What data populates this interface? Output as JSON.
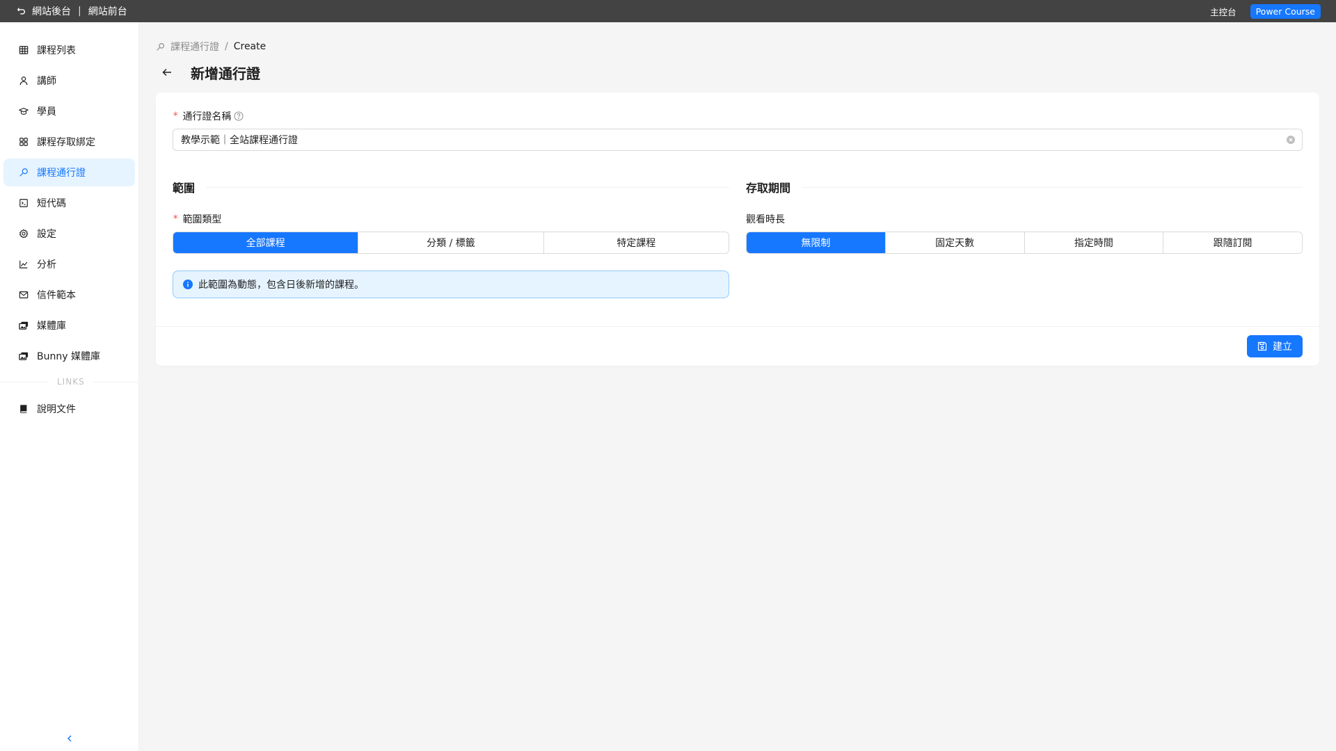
{
  "topbar": {
    "backend_label": "網站後台",
    "separator": "|",
    "frontend_label": "網站前台",
    "console_label": "主控台",
    "brand_label": "Power Course"
  },
  "sidebar": {
    "items": [
      {
        "label": "課程列表",
        "icon": "table-icon"
      },
      {
        "label": "講師",
        "icon": "user-icon"
      },
      {
        "label": "學員",
        "icon": "student-cap-icon"
      },
      {
        "label": "課程存取綁定",
        "icon": "apps-icon"
      },
      {
        "label": "課程通行證",
        "icon": "key-icon",
        "active": true
      },
      {
        "label": "短代碼",
        "icon": "code-icon"
      },
      {
        "label": "設定",
        "icon": "gear-icon"
      },
      {
        "label": "分析",
        "icon": "chart-line-icon"
      },
      {
        "label": "信件範本",
        "icon": "mail-icon"
      },
      {
        "label": "媒體庫",
        "icon": "media-icon"
      },
      {
        "label": "Bunny 媒體庫",
        "icon": "media-icon"
      }
    ],
    "links_divider": "LINKS",
    "links": [
      {
        "label": "說明文件",
        "icon": "book-icon"
      }
    ]
  },
  "breadcrumb": {
    "parent": "課程通行證",
    "separator": "/",
    "current": "Create"
  },
  "page_title": "新增通行證",
  "form": {
    "name_label": "通行證名稱",
    "name_value": "教學示範｜全站課程通行證",
    "scope_section": "範圍",
    "scope_type_label": "範圍類型",
    "scope_options": [
      "全部課程",
      "分類 / 標籤",
      "特定課程"
    ],
    "scope_selected": 0,
    "scope_info": "此範圍為動態，包含日後新增的課程。",
    "access_section": "存取期間",
    "duration_label": "觀看時長",
    "duration_options": [
      "無限制",
      "固定天數",
      "指定時間",
      "跟隨訂閱"
    ],
    "duration_selected": 0,
    "submit_label": "建立"
  },
  "colors": {
    "primary": "#1677ff",
    "topbar": "#434343",
    "required": "#ff4d4f",
    "info_bg": "#e6f4ff"
  }
}
